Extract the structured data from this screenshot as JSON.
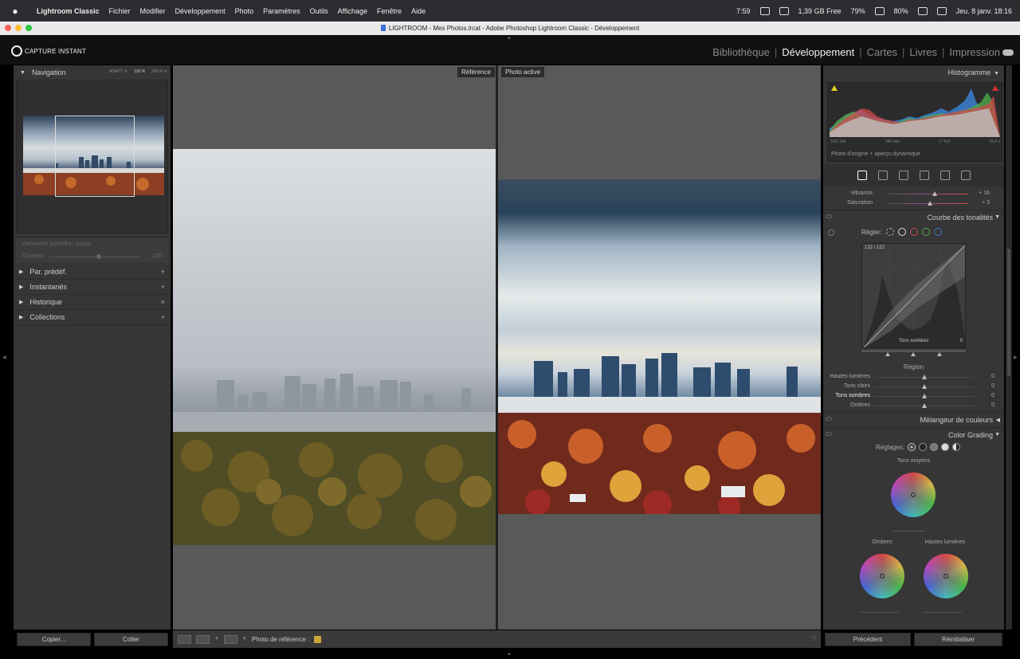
{
  "menubar": {
    "app": "Lightroom Classic",
    "items": [
      "Fichier",
      "Modifier",
      "Développement",
      "Photo",
      "Paramètres",
      "Outils",
      "Affichage",
      "Fenêtre",
      "Aide"
    ],
    "status": {
      "time_short": "7:59",
      "disk": "1,39 GB Free",
      "cpu": "79%",
      "battery": "80%",
      "clock": "Jeu. 8 janv.  18:16"
    }
  },
  "window": {
    "title": "LIGHTROOM - Mes Photos.lrcat - Adobe Photoshop Lightroom Classic - Développement"
  },
  "brand": {
    "logo_text": "CAPTURE INSTANT"
  },
  "modules": [
    "Bibliothèque",
    "Développement",
    "Cartes",
    "Livres",
    "Impression"
  ],
  "left_panel": {
    "navigation": {
      "title": "Navigation",
      "zoom": [
        "ADAPT. ≑",
        "100 %",
        "200 % ≑"
      ]
    },
    "preset": {
      "label": "Paramètre prédéfini : Aucun",
      "qty_label": "Quantité",
      "qty_value": "100",
      "qty_level": 0.55
    },
    "sections": [
      {
        "label": "Par. prédéf.",
        "action": "+"
      },
      {
        "label": "Instantanés",
        "action": "+"
      },
      {
        "label": "Historique",
        "action": "×"
      },
      {
        "label": "Collections",
        "action": "+"
      }
    ],
    "copy_button": "Copier...",
    "paste_button": "Coller"
  },
  "center": {
    "reference_label": "Référence",
    "active_label": "Photo active",
    "toolbar": {
      "ref_photo_label": "Photo de référence :"
    }
  },
  "right_panel": {
    "histogram": {
      "title": "Histogramme",
      "iso": "ISO 100",
      "focal": "160 mm",
      "aperture": "ƒ / 8,0",
      "shutter": "15,0 s",
      "note": "Photo d'origine + aperçu dynamique"
    },
    "presence": [
      {
        "label": "Vibrance",
        "value": "+ 16",
        "level": 0.58
      },
      {
        "label": "Saturation",
        "value": "+ 3",
        "level": 0.52
      }
    ],
    "tone_curve": {
      "title": "Courbe des tonalités",
      "adjust_label": "Régler:",
      "coord": "122 / 122",
      "region_hover": "Tons sombres",
      "zero": "0",
      "region_title": "Région",
      "sliders": [
        {
          "label": "Hautes lumières",
          "value": "0",
          "level": 0.5
        },
        {
          "label": "Tons clairs",
          "value": "0",
          "level": 0.5
        },
        {
          "label": "Tons sombres",
          "value": "0",
          "level": 0.5
        },
        {
          "label": "Ombres",
          "value": "0",
          "level": 0.5
        }
      ]
    },
    "mixer": {
      "title": "Mélangeur de couleurs"
    },
    "color_grading": {
      "title": "Color Grading",
      "adjust_label": "Réglages:",
      "midtones": "Tons moyens",
      "shadows": "Ombres",
      "highlights": "Hautes lumières"
    },
    "previous_button": "Précédent",
    "reset_button": "Réinitialiser"
  }
}
